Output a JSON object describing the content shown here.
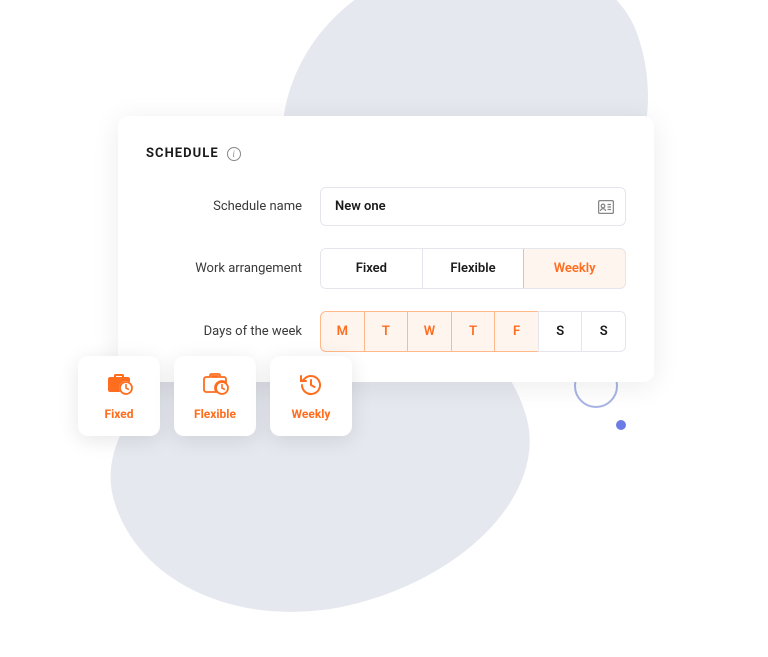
{
  "header": {
    "title": "SCHEDULE"
  },
  "fields": {
    "name_label": "Schedule name",
    "name_value": "New one",
    "arrangement_label": "Work arrangement",
    "days_label": "Days of the week"
  },
  "arrangement_options": [
    {
      "label": "Fixed",
      "active": false
    },
    {
      "label": "Flexible",
      "active": false
    },
    {
      "label": "Weekly",
      "active": true
    }
  ],
  "days": [
    {
      "label": "M",
      "active": true
    },
    {
      "label": "T",
      "active": true
    },
    {
      "label": "W",
      "active": true
    },
    {
      "label": "T",
      "active": true
    },
    {
      "label": "F",
      "active": true
    },
    {
      "label": "S",
      "active": false
    },
    {
      "label": "S",
      "active": false
    }
  ],
  "tiles": [
    {
      "label": "Fixed",
      "icon": "briefcase-clock-icon"
    },
    {
      "label": "Flexible",
      "icon": "briefcase-clock-open-icon"
    },
    {
      "label": "Weekly",
      "icon": "history-clock-icon"
    }
  ],
  "colors": {
    "accent": "#ff6d1f"
  }
}
